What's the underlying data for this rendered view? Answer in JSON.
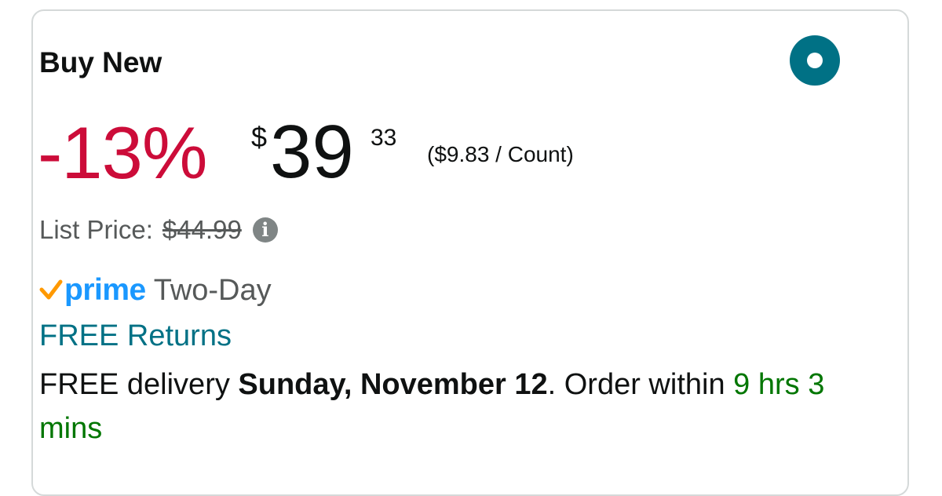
{
  "offer": {
    "title": "Buy New",
    "selected": true,
    "accent_color": "#007185"
  },
  "price": {
    "discount": "-13%",
    "currency_symbol": "$",
    "whole": "39",
    "fraction": "33",
    "unit_price": "($9.83 / Count)",
    "discount_color": "#cc0c39"
  },
  "list_price": {
    "label": "List Price:",
    "value": "$44.99",
    "info_icon": "info-icon",
    "info_glyph": "i"
  },
  "prime": {
    "logo_text": "prime",
    "speed": "Two-Day",
    "check_color": "#ff9900",
    "logo_color": "#1a98ff"
  },
  "returns": {
    "label": "FREE Returns"
  },
  "delivery": {
    "prefix": "FREE delivery ",
    "date": "Sunday, November 12",
    "middle": ". Order within ",
    "countdown": "9 hrs 3 mins"
  }
}
